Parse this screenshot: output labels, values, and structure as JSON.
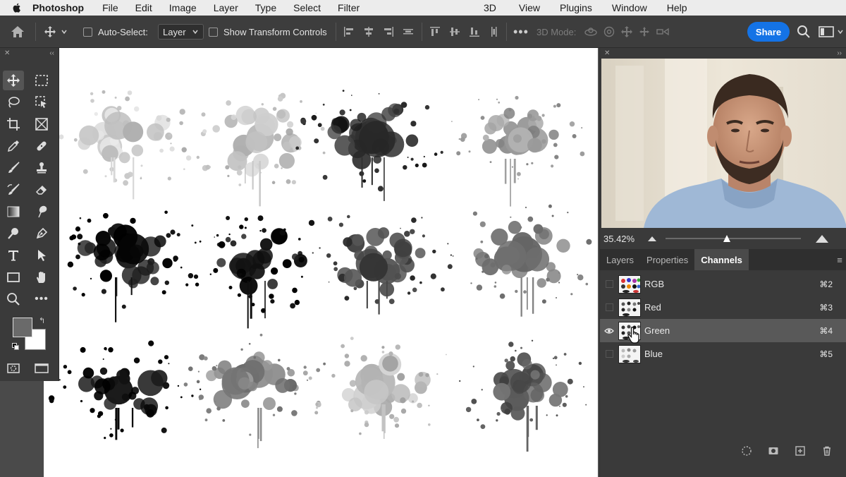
{
  "menubar": {
    "app_name": "Photoshop",
    "items": [
      "File",
      "Edit",
      "Image",
      "Layer",
      "Type",
      "Select",
      "Filter"
    ],
    "items_right": [
      "3D",
      "View",
      "Plugins",
      "Window",
      "Help"
    ]
  },
  "options_bar": {
    "auto_select_label": "Auto-Select:",
    "auto_select_value": "Layer",
    "show_transform_label": "Show Transform Controls",
    "mode_3d_label": "3D Mode:",
    "share_label": "Share"
  },
  "navigator": {
    "zoom": "35.42%",
    "zoom_slider_fraction": 0.45
  },
  "panel_tabs": {
    "layers": "Layers",
    "properties": "Properties",
    "channels": "Channels",
    "active": "Channels"
  },
  "channels": [
    {
      "name": "RGB",
      "shortcut": "⌘2",
      "visible": false,
      "selected": false
    },
    {
      "name": "Red",
      "shortcut": "⌘3",
      "visible": false,
      "selected": false
    },
    {
      "name": "Green",
      "shortcut": "⌘4",
      "visible": true,
      "selected": true
    },
    {
      "name": "Blue",
      "shortcut": "⌘5",
      "visible": false,
      "selected": false
    }
  ],
  "colors": {
    "accent": "#1473e6",
    "panel_bg": "#3a3a3a",
    "menubar_bg": "#ececec"
  }
}
